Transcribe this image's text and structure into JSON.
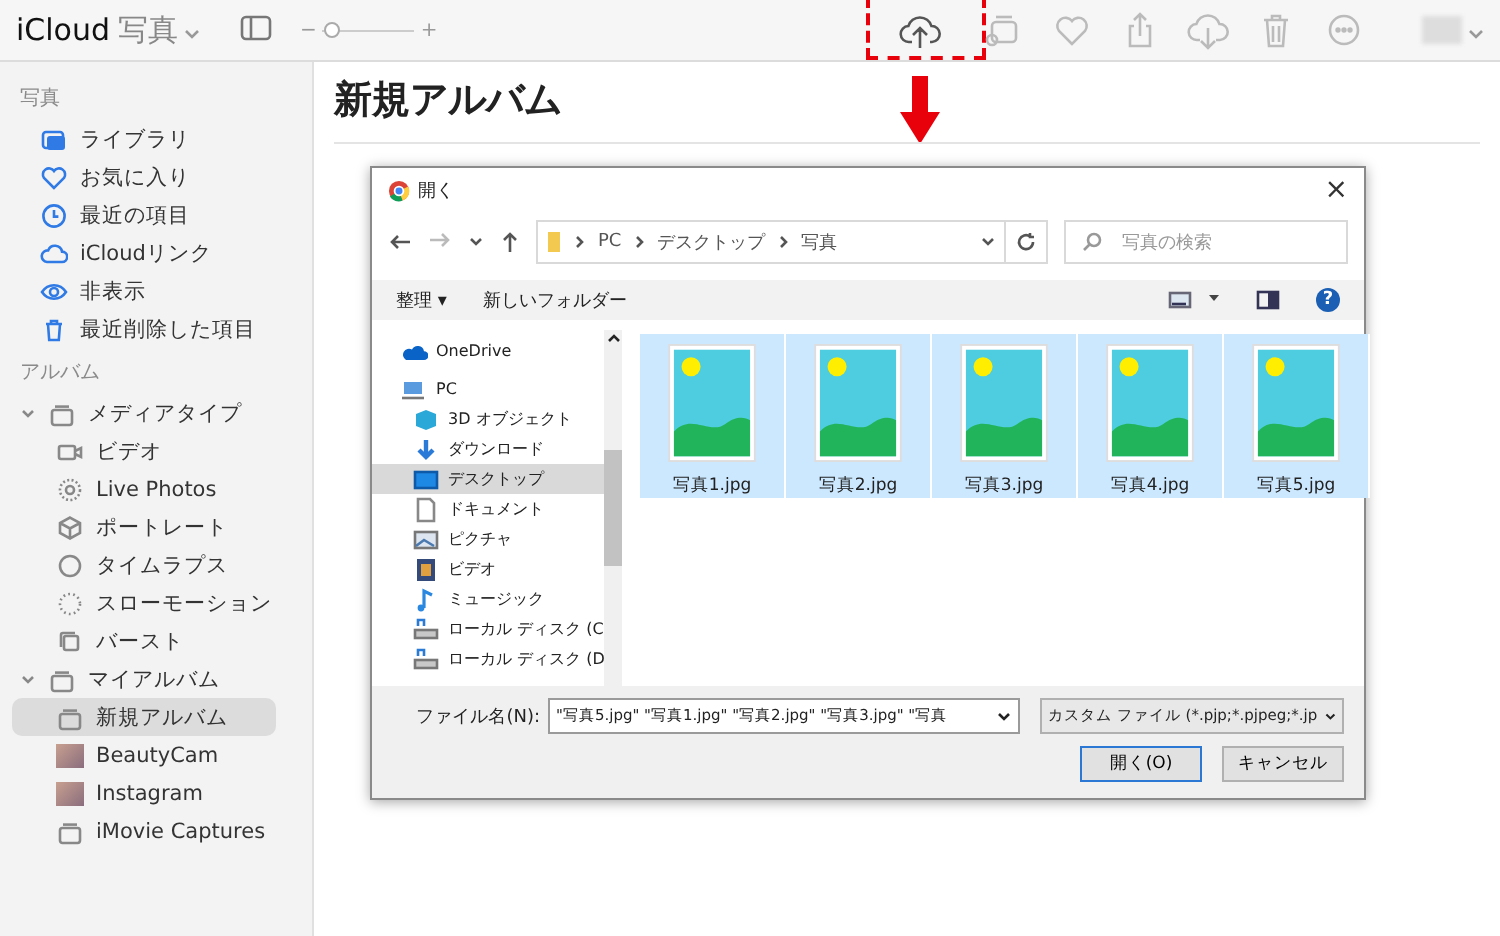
{
  "app": {
    "brand": "iCloud",
    "title": "写真",
    "slider": {
      "minus": "−",
      "plus": "+",
      "level": 0.1
    }
  },
  "toolbar": [
    {
      "kind": "upload",
      "highlighted": true
    },
    {
      "kind": "album",
      "highlighted": false
    },
    {
      "kind": "heart",
      "highlighted": false
    },
    {
      "kind": "share",
      "highlighted": false
    },
    {
      "kind": "download",
      "highlighted": false
    },
    {
      "kind": "trash",
      "highlighted": false
    },
    {
      "kind": "more",
      "highlighted": false
    }
  ],
  "sidebar": {
    "sections": [
      {
        "heading": "写真",
        "items": [
          {
            "label": "ライブラリ",
            "selected": false
          },
          {
            "label": "お気に入り",
            "selected": false
          },
          {
            "label": "最近の項目",
            "selected": false
          },
          {
            "label": "iCloudリンク",
            "selected": false
          },
          {
            "label": "非表示",
            "selected": false
          },
          {
            "label": "最近削除した項目",
            "selected": false
          }
        ]
      },
      {
        "heading": "アルバム",
        "items": [
          {
            "label": "メディアタイプ",
            "selected": false,
            "expanded": true,
            "children": [
              {
                "label": "ビデオ",
                "selected": false
              },
              {
                "label": "Live Photos",
                "selected": false
              },
              {
                "label": "ポートレート",
                "selected": false
              },
              {
                "label": "タイムラプス",
                "selected": false
              },
              {
                "label": "スローモーション",
                "selected": false
              },
              {
                "label": "バースト",
                "selected": false
              }
            ]
          },
          {
            "label": "マイアルバム",
            "selected": false,
            "expanded": true,
            "children": [
              {
                "label": "新規アルバム",
                "selected": true
              },
              {
                "label": "BeautyCam",
                "selected": false
              },
              {
                "label": "Instagram",
                "selected": false
              },
              {
                "label": "iMovie Captures",
                "selected": false
              }
            ]
          }
        ]
      }
    ]
  },
  "main": {
    "title": "新規アルバム"
  },
  "dialog": {
    "title": "開く",
    "close": "×",
    "breadcrumb": [
      "PC",
      "デスクトップ",
      "写真"
    ],
    "search": {
      "placeholder": "写真の検索"
    },
    "commands": [
      "整理 ▾",
      "新しいフォルダー"
    ],
    "help": "?",
    "nav": [
      {
        "label": "OneDrive",
        "selected": false
      },
      {
        "label": "PC",
        "selected": false,
        "children": [
          {
            "label": "3D オブジェクト",
            "selected": false
          },
          {
            "label": "ダウンロード",
            "selected": false
          },
          {
            "label": "デスクトップ",
            "selected": true
          },
          {
            "label": "ドキュメント",
            "selected": false
          },
          {
            "label": "ピクチャ",
            "selected": false
          },
          {
            "label": "ビデオ",
            "selected": false
          },
          {
            "label": "ミュージック",
            "selected": false
          },
          {
            "label": "ローカル ディスク (C",
            "selected": false
          },
          {
            "label": "ローカル ディスク (D",
            "selected": false
          }
        ]
      }
    ],
    "files": [
      {
        "name": "写真1.jpg",
        "selected": true
      },
      {
        "name": "写真2.jpg",
        "selected": true
      },
      {
        "name": "写真3.jpg",
        "selected": true
      },
      {
        "name": "写真4.jpg",
        "selected": true
      },
      {
        "name": "写真5.jpg",
        "selected": true
      }
    ],
    "filename_label": "ファイル名(N):",
    "filename_value": "\"写真5.jpg\" \"写真1.jpg\" \"写真2.jpg\" \"写真3.jpg\" \"写真",
    "filter": "カスタム ファイル (*.pjp;*.pjpeg;*.jp",
    "buttons": [
      {
        "label": "開く(O)",
        "kind": "primary"
      },
      {
        "label": "キャンセル",
        "kind": "normal"
      }
    ]
  }
}
